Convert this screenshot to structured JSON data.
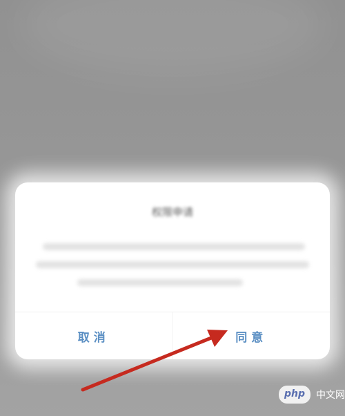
{
  "dialog": {
    "title": "权限申请",
    "cancel_label": "取消",
    "agree_label": "同意"
  },
  "watermark": {
    "logo_text": "php",
    "site_text": "中文网"
  },
  "colors": {
    "background": "#9a9a9a",
    "button_text": "#5b8fc3",
    "annotation_arrow": "#c62a1f"
  }
}
